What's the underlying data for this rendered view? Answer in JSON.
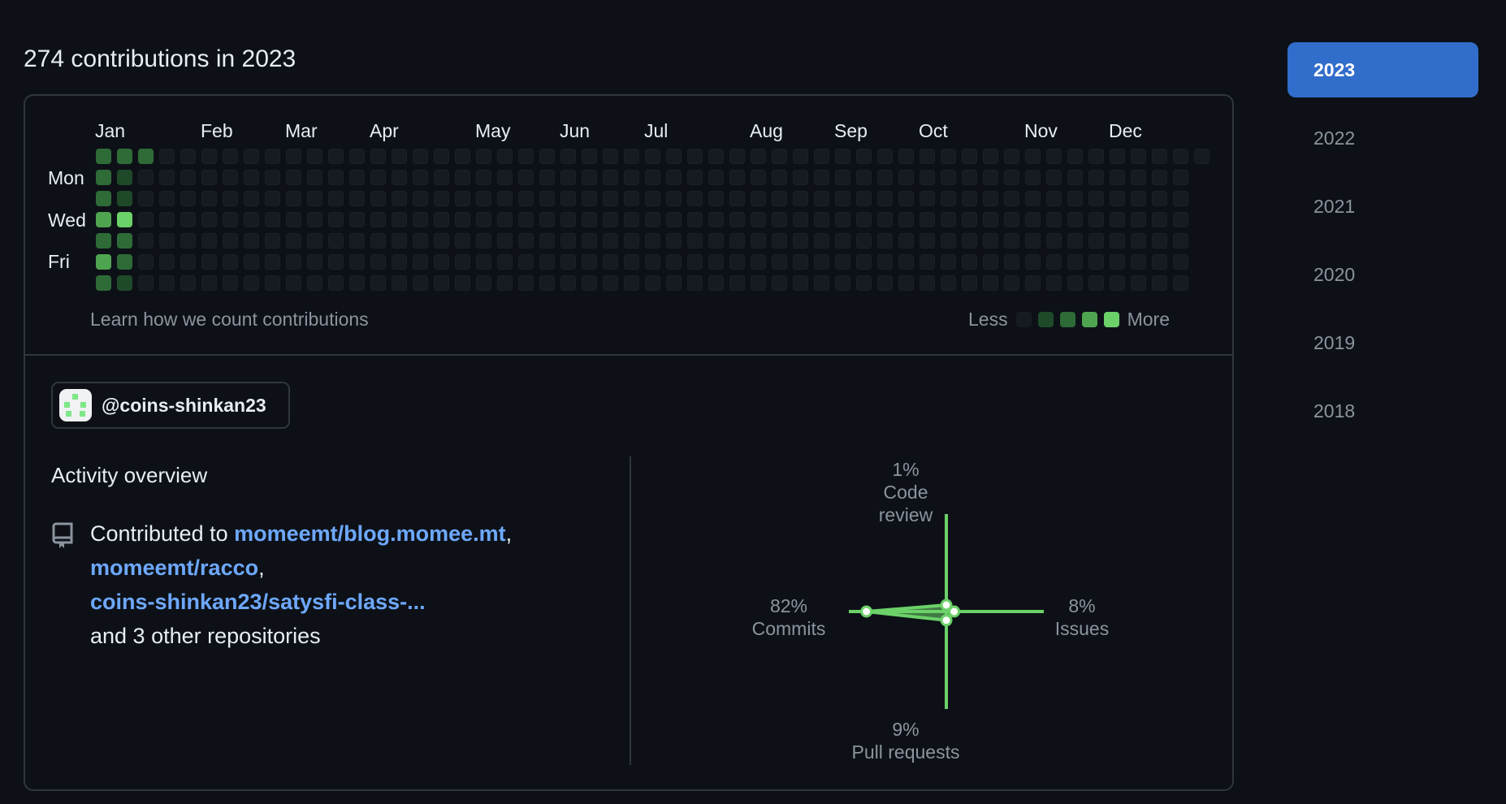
{
  "headline": "274 contributions in 2023",
  "calendar": {
    "months": [
      "Jan",
      "Feb",
      "Mar",
      "Apr",
      "May",
      "Jun",
      "Jul",
      "Aug",
      "Sep",
      "Oct",
      "Nov",
      "Dec"
    ],
    "days": [
      "Mon",
      "Wed",
      "Fri"
    ],
    "learn_link": "Learn how we count contributions",
    "legend_less": "Less",
    "legend_more": "More",
    "levels": [
      "#161b22",
      "#1f4a2a",
      "#2e6b37",
      "#4fa54f",
      "#6bd168"
    ],
    "active_weeks": [
      [
        0,
        [
          2,
          2,
          2,
          3,
          2,
          3,
          2
        ]
      ],
      [
        1,
        [
          2,
          1,
          1,
          4,
          2,
          2,
          1
        ]
      ],
      [
        2,
        [
          2,
          0,
          0,
          0,
          0,
          0,
          0
        ]
      ]
    ]
  },
  "user": {
    "handle": "@coins-shinkan23"
  },
  "activity": {
    "title": "Activity overview",
    "prefix": "Contributed to ",
    "repo1": "momeemt/blog.momee.mt",
    "repo2": "momeemt/racco",
    "repo3": "coins-shinkan23/satysfi-class-...",
    "suffix": "and 3 other repositories",
    "comma": ","
  },
  "radar": {
    "code_review_pct": "1%",
    "code_review_label": "Code review",
    "issues_pct": "8%",
    "issues_label": "Issues",
    "pull_requests_pct": "9%",
    "pull_requests_label": "Pull requests",
    "commits_pct": "82%",
    "commits_label": "Commits",
    "values": {
      "code_review": 1,
      "issues": 8,
      "pull_requests": 9,
      "commits": 82
    },
    "color": "#6bd168"
  },
  "years": [
    "2023",
    "2022",
    "2021",
    "2020",
    "2019",
    "2018"
  ]
}
